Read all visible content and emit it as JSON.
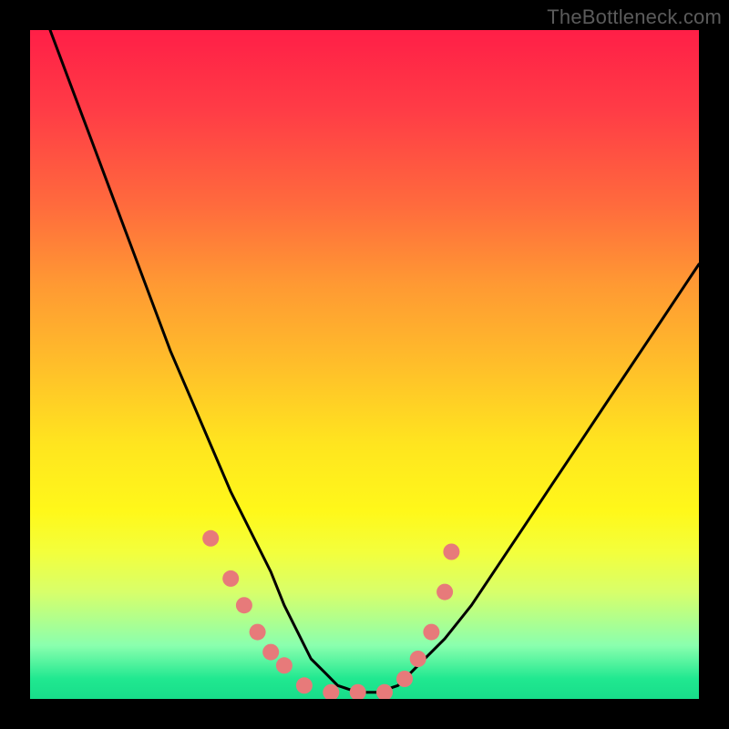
{
  "watermark": "TheBottleneck.com",
  "chart_data": {
    "type": "line",
    "title": "",
    "xlabel": "",
    "ylabel": "",
    "xlim": [
      0,
      100
    ],
    "ylim": [
      0,
      100
    ],
    "series": [
      {
        "name": "bottleneck-curve",
        "x": [
          3,
          6,
          9,
          12,
          15,
          18,
          21,
          24,
          27,
          30,
          33,
          36,
          38,
          40,
          42,
          44,
          46,
          49,
          52,
          55,
          58,
          62,
          66,
          70,
          74,
          78,
          82,
          86,
          90,
          94,
          98,
          100
        ],
        "y": [
          100,
          92,
          84,
          76,
          68,
          60,
          52,
          45,
          38,
          31,
          25,
          19,
          14,
          10,
          6,
          4,
          2,
          1,
          1,
          2,
          5,
          9,
          14,
          20,
          26,
          32,
          38,
          44,
          50,
          56,
          62,
          65
        ]
      },
      {
        "name": "marker-dots",
        "x": [
          27,
          30,
          32,
          34,
          36,
          38,
          41,
          45,
          49,
          53,
          56,
          58,
          60,
          62,
          63
        ],
        "y": [
          24,
          18,
          14,
          10,
          7,
          5,
          2,
          1,
          1,
          1,
          3,
          6,
          10,
          16,
          22
        ]
      }
    ],
    "colors": {
      "curve": "#000000",
      "dots": "#e77a7a"
    }
  }
}
